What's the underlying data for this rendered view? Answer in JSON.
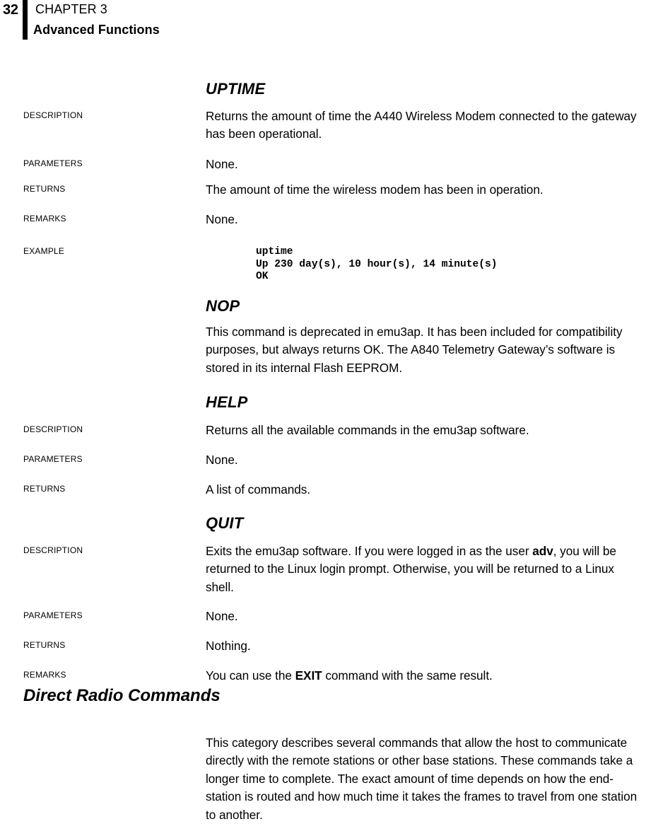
{
  "running_head": {
    "page_number": "32",
    "chapter_label": "CHAPTER 3",
    "chapter_title": "Advanced Functions"
  },
  "commands": [
    {
      "name": "UPTIME",
      "rows": [
        {
          "label": "Description",
          "value": "Returns the amount of time the A440 Wireless Modem connected to the gateway has been operational."
        },
        {
          "label": "Parameters",
          "value": "None."
        },
        {
          "label": "Returns",
          "value": "The amount of time the wireless modem has been in operation."
        },
        {
          "label": "Remarks",
          "value": "None."
        },
        {
          "label": "Example",
          "value": ""
        }
      ],
      "example_code": "uptime\nUp 230 day(s), 10 hour(s), 14 minute(s)\nOK"
    },
    {
      "name": "NOP",
      "paragraph": "This command is deprecated in emu3ap. It has been included for compatibility purposes, but always returns OK. The A840 Telemetry Gateway’s software is stored in its internal Flash EEPROM."
    },
    {
      "name": "HELP",
      "rows": [
        {
          "label": "Description",
          "value": "Returns all the available commands in the emu3ap software."
        },
        {
          "label": "Parameters",
          "value": "None."
        },
        {
          "label": "Returns",
          "value": "A list of commands."
        }
      ]
    },
    {
      "name": "QUIT",
      "rows": [
        {
          "label": "Description",
          "value_pre": "Exits the emu3ap software. If you were logged in as the user ",
          "value_bold": "adv",
          "value_post": ", you will be returned to the Linux login prompt. Otherwise, you will be returned to a Linux shell."
        },
        {
          "label": "Parameters",
          "value": "None."
        },
        {
          "label": "Returns",
          "value": "Nothing."
        },
        {
          "label": "Remarks",
          "value_pre": "You can use the ",
          "value_bold": "EXIT",
          "value_post": " command with the same result."
        }
      ]
    }
  ],
  "section": {
    "heading": "Direct Radio Commands",
    "paragraph": "This category describes several commands that allow the host to communicate directly with the remote stations or other base stations. These commands take a longer time to complete. The exact amount of time depends on how the end-station is routed and how much time it takes the frames to travel from one station to another."
  }
}
